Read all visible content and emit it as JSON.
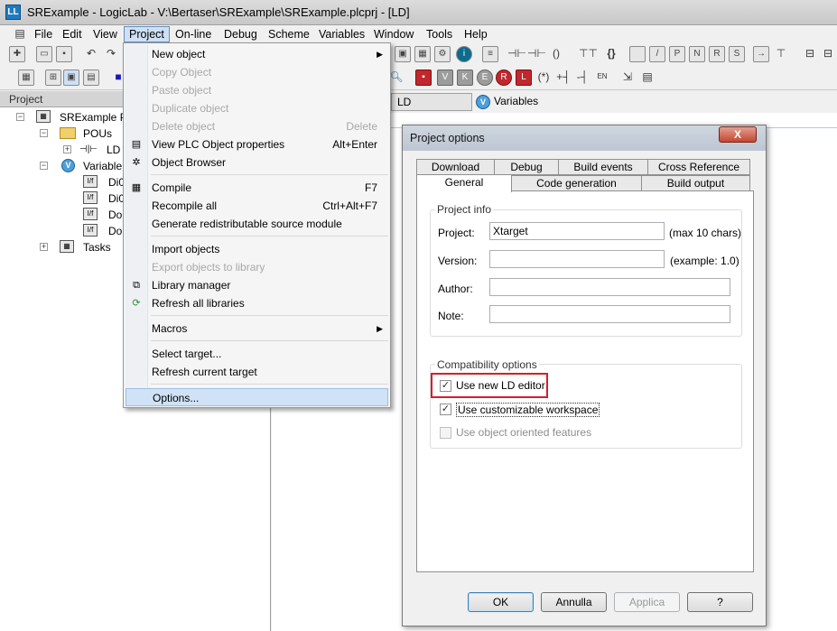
{
  "window": {
    "title": "SRExample - LogicLab - V:\\Bertaser\\SRExample\\SRExample.plcprj - [LD]",
    "app_icon": "logiclab-icon"
  },
  "menubar": {
    "items": [
      "File",
      "Edit",
      "View",
      "Project",
      "On-line",
      "Debug",
      "Scheme",
      "Variables",
      "Window",
      "Tools",
      "Help"
    ],
    "active": "Project"
  },
  "project_panel": {
    "header": "Project",
    "tree": {
      "root": "SRExample Pr",
      "pous": "POUs",
      "pou_ld": "LD",
      "variables": "Variable",
      "vars": [
        "Di0",
        "Di0",
        "Do",
        "Do"
      ],
      "tasks": "Tasks"
    }
  },
  "editor": {
    "tab_ld": "LD",
    "tab_variables": "Variables"
  },
  "project_menu": {
    "items": [
      {
        "label": "New object",
        "shortcut": "",
        "submenu": true,
        "disabled": false
      },
      {
        "label": "Copy Object",
        "shortcut": "",
        "disabled": true
      },
      {
        "label": "Paste object",
        "shortcut": "",
        "disabled": true
      },
      {
        "label": "Duplicate object",
        "shortcut": "",
        "disabled": true
      },
      {
        "label": "Delete object",
        "shortcut": "Delete",
        "disabled": true
      },
      {
        "label": "View PLC Object properties",
        "shortcut": "Alt+Enter",
        "disabled": false
      },
      {
        "label": "Object Browser",
        "shortcut": "",
        "disabled": false
      },
      {
        "label": "Compile",
        "shortcut": "F7",
        "disabled": false
      },
      {
        "label": "Recompile all",
        "shortcut": "Ctrl+Alt+F7",
        "disabled": false
      },
      {
        "label": "Generate redistributable source module",
        "shortcut": "",
        "disabled": false
      },
      {
        "label": "Import objects",
        "shortcut": "",
        "disabled": false
      },
      {
        "label": "Export objects to library",
        "shortcut": "",
        "disabled": true
      },
      {
        "label": "Library manager",
        "shortcut": "",
        "disabled": false
      },
      {
        "label": "Refresh all libraries",
        "shortcut": "",
        "disabled": false
      },
      {
        "label": "Macros",
        "shortcut": "",
        "submenu": true,
        "disabled": false
      },
      {
        "label": "Select target...",
        "shortcut": "",
        "disabled": false
      },
      {
        "label": "Refresh current target",
        "shortcut": "",
        "disabled": false
      },
      {
        "label": "Options...",
        "shortcut": "",
        "disabled": false,
        "highlighted": true
      }
    ]
  },
  "dialog": {
    "title": "Project options",
    "close": "X",
    "tabs_row1": [
      "Download",
      "Debug",
      "Build events",
      "Cross Reference"
    ],
    "tabs_row2": [
      "General",
      "Code generation",
      "Build output"
    ],
    "selected_tab": "General",
    "project_info": {
      "legend": "Project info",
      "project_label": "Project:",
      "project_value": "Xtarget",
      "project_hint": "(max 10 chars)",
      "version_label": "Version:",
      "version_value": "",
      "version_hint": "(example: 1.0)",
      "author_label": "Author:",
      "author_value": "",
      "note_label": "Note:",
      "note_value": ""
    },
    "compatibility": {
      "legend": "Compatibility options",
      "use_new_ld_editor": "Use new LD editor",
      "use_new_ld_editor_checked": true,
      "use_customizable_workspace": "Use customizable workspace",
      "use_customizable_workspace_checked": true,
      "use_object_oriented": "Use object oriented features",
      "use_object_oriented_checked": false
    },
    "buttons": {
      "ok": "OK",
      "cancel": "Annulla",
      "apply": "Applica",
      "help": "?"
    }
  },
  "colors": {
    "highlight_box": "#d1202a",
    "menu_highlight": "#d0e2f6"
  }
}
